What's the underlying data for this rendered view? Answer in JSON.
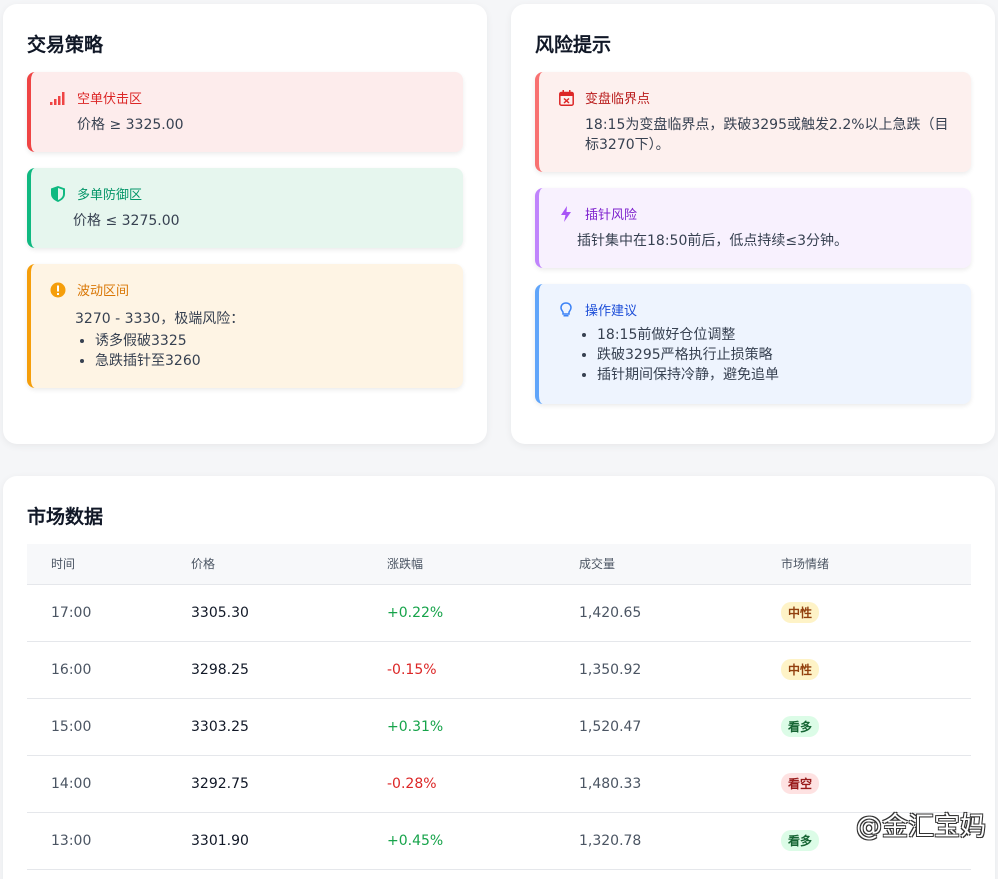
{
  "strategy": {
    "title": "交易策略",
    "short_zone": {
      "label": "空单伏击区",
      "text": "价格 ≥ 3325.00",
      "icon": "signal-bars-icon"
    },
    "long_zone": {
      "label": "多单防御区",
      "text": "价格 ≤ 3275.00",
      "icon": "shield-icon"
    },
    "range": {
      "label": "波动区间",
      "text": "3270 - 3330，极端风险：",
      "items": [
        "诱多假破3325",
        "急跌插针至3260"
      ],
      "icon": "exclamation-circle-icon"
    }
  },
  "risk": {
    "title": "风险提示",
    "turning": {
      "label": "变盘临界点",
      "text": "18:15为变盘临界点，跌破3295或触发2.2%以上急跌（目标3270下）。",
      "icon": "calendar-x-icon"
    },
    "spike": {
      "label": "插针风险",
      "text": "插针集中在18:50前后，低点持续≤3分钟。",
      "icon": "lightning-icon"
    },
    "advice": {
      "label": "操作建议",
      "items": [
        "18:15前做好仓位调整",
        "跌破3295严格执行止损策略",
        "插针期间保持冷静，避免追单"
      ],
      "icon": "lightbulb-icon"
    }
  },
  "market": {
    "title": "市场数据",
    "headers": [
      "时间",
      "价格",
      "涨跌幅",
      "成交量",
      "市场情绪"
    ],
    "rows": [
      {
        "time": "17:00",
        "price": "3305.30",
        "change": "+0.22%",
        "volume": "1,420.65",
        "sentiment": "中性"
      },
      {
        "time": "16:00",
        "price": "3298.25",
        "change": "-0.15%",
        "volume": "1,350.92",
        "sentiment": "中性"
      },
      {
        "time": "15:00",
        "price": "3303.25",
        "change": "+0.31%",
        "volume": "1,520.47",
        "sentiment": "看多"
      },
      {
        "time": "14:00",
        "price": "3292.75",
        "change": "-0.28%",
        "volume": "1,480.33",
        "sentiment": "看空"
      },
      {
        "time": "13:00",
        "price": "3301.90",
        "change": "+0.45%",
        "volume": "1,320.78",
        "sentiment": "看多"
      }
    ]
  },
  "watermark": "@金汇宝妈",
  "colors": {
    "up": "#16a34a",
    "down": "#dc2626",
    "neutral_badge": "#fef3c7",
    "bull_badge": "#dcfce7",
    "bear_badge": "#fee2e2"
  }
}
